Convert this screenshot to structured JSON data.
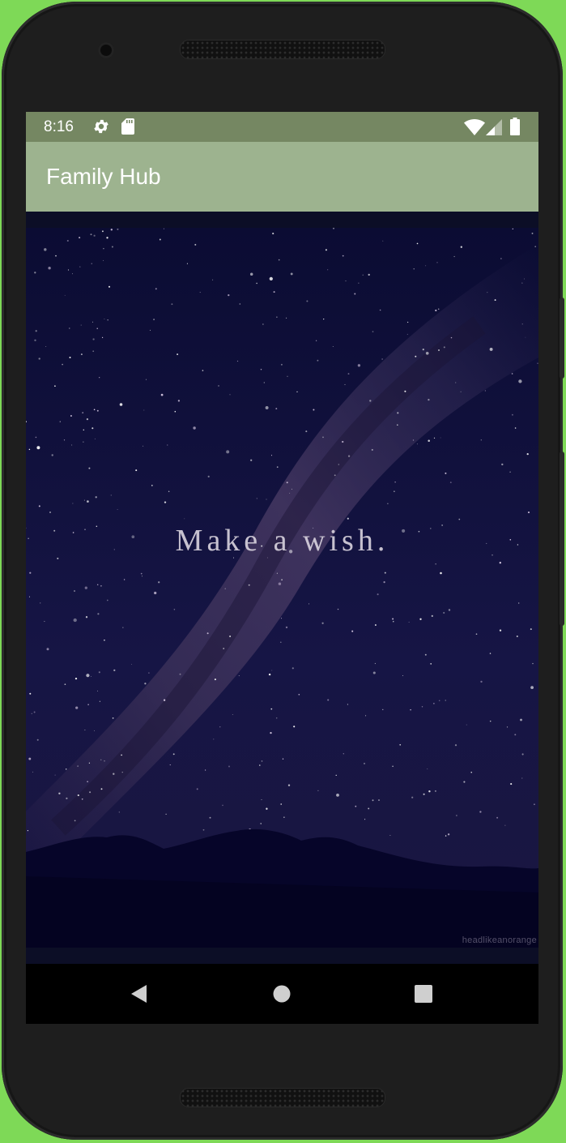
{
  "status_bar": {
    "time": "8:16",
    "left_icons": [
      "gear-icon",
      "sd-card-icon"
    ],
    "right_icons": [
      "wifi-icon",
      "cell-signal-icon",
      "battery-icon"
    ],
    "background": "#758762"
  },
  "app_bar": {
    "title": "Family Hub",
    "background": "#9db38f"
  },
  "content": {
    "image_caption": "Make a wish.",
    "watermark": "headlikeanorange"
  },
  "nav_bar": {
    "buttons": [
      "back-icon",
      "home-icon",
      "recent-apps-icon"
    ]
  },
  "colors": {
    "page_background": "#7ed957",
    "device_frame": "#1e1e1e",
    "sky": "#0c0e26"
  }
}
